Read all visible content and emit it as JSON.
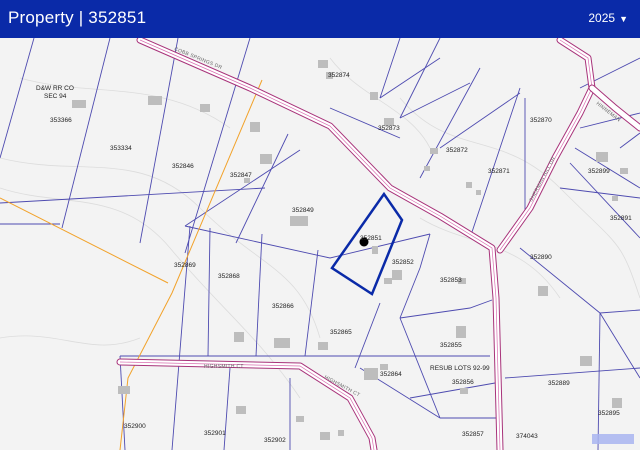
{
  "header": {
    "title": "Property | 352851",
    "year": "2025",
    "year_caret": "chevron-down-icon"
  },
  "map": {
    "parcel_labels": {
      "p353366_owner1": "D&W RR CO",
      "p353366_owner2": "SEC 94",
      "p353366": "353366",
      "p353334": "353334",
      "p352846": "352846",
      "p352847": "352847",
      "p352874": "352874",
      "p352873": "352873",
      "p352872": "352872",
      "p352871": "352871",
      "p352870": "352870",
      "p352899": "352899",
      "p352891": "352891",
      "p352849": "352849",
      "p352851": "352851",
      "p352852": "352852",
      "p352853": "352853",
      "p352890": "352890",
      "p352869": "352869",
      "p352868": "352868",
      "p352866": "352866",
      "p352865": "352865",
      "p352855": "352855",
      "p352864": "352864",
      "resub": "RESUB LOTS 92-99",
      "p352856": "352856",
      "p352889": "352889",
      "p352895": "352895",
      "p352900": "352900",
      "p352901": "352901",
      "p352902": "352902",
      "p352857": "352857",
      "p374043": "374043"
    },
    "street_labels": {
      "cobb_springs": "COBB SPRINGS DR",
      "sherman": "SHERMAN HILL DR",
      "hinneman": "HINNEMAN",
      "highsmith": "HIGHSMITH CT",
      "highsmith2": "HIGHSMITH CT"
    },
    "selected_parcel": "352851",
    "colors": {
      "header": "#0a2aa8",
      "selected_outline": "#0a2aa8",
      "lot_lines": "#4e4bb0",
      "road_outline": "#a8337a",
      "rail_line": "#f2a22a"
    }
  }
}
